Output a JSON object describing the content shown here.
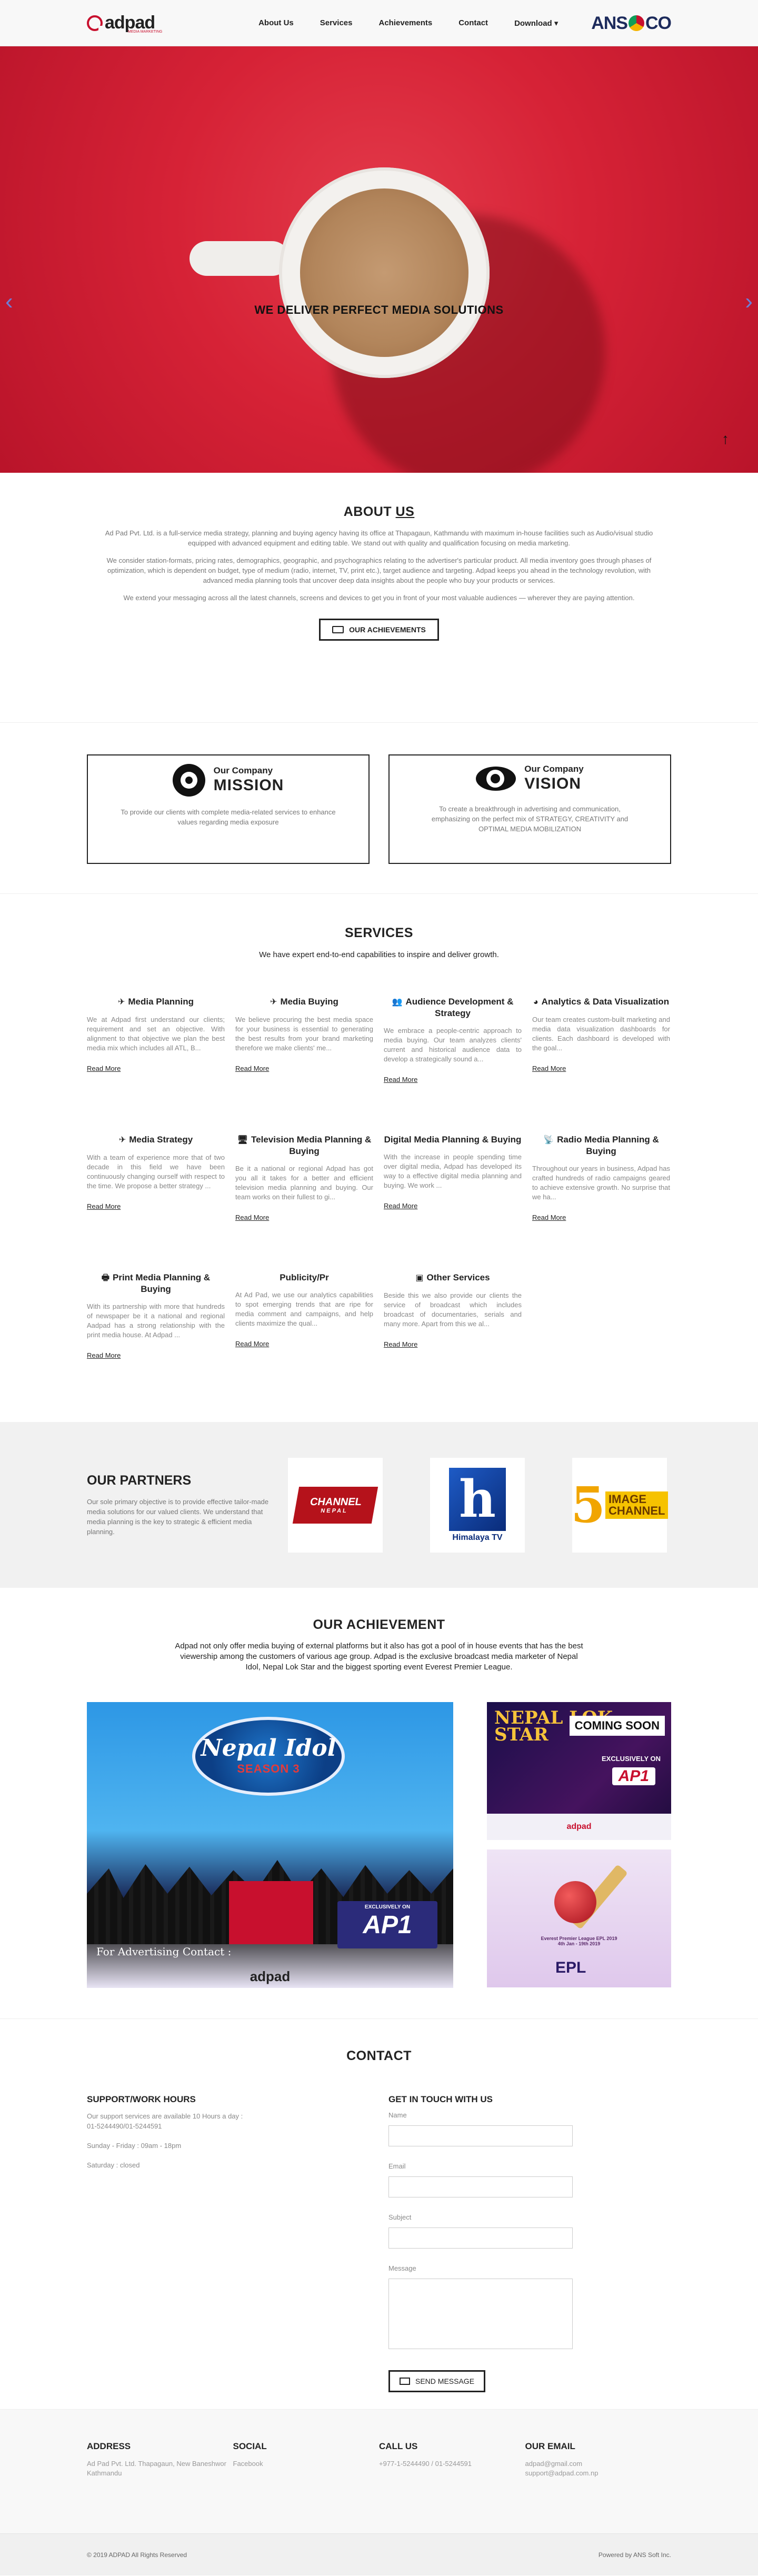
{
  "nav": {
    "logo_text": "adpad",
    "logo_sub": "MEDIA MARKETING",
    "links": [
      "About Us",
      "Services",
      "Achievements",
      "Contact",
      "Download"
    ],
    "partner_logo": "ANSCO"
  },
  "hero": {
    "caption": "WE DELIVER PERFECT MEDIA SOLUTIONS",
    "prev_icon": "‹",
    "next_icon": "›",
    "scroll_top_icon": "↑"
  },
  "about": {
    "title_a": "ABOUT ",
    "title_b": "US",
    "p1": "Ad Pad Pvt. Ltd. is a full-service media strategy, planning and buying agency having its office at Thapagaun, Kathmandu with maximum in-house facilities such as Audio/visual studio equipped with advanced equipment and editing table. We stand out with quality and qualification focusing on media marketing.",
    "p2": "We consider station-formats, pricing rates, demographics, geographic, and psychographics relating to the advertiser's particular product. All media inventory goes through phases of optimization, which is dependent on budget, type of medium (radio, internet, TV, print etc.), target audience and targeting. Adpad keeps you ahead in the technology revolution, with advanced media planning tools that uncover deep data insights about the people who buy your products or services.",
    "p3": "We extend your messaging across all the latest channels, screens and devices to get you in front of your most valuable audiences — wherever they are paying attention.",
    "button": "OUR ACHIEVEMENTS"
  },
  "mission": {
    "prefix": "Our Company",
    "title": "MISSION",
    "text": "To provide our clients with complete media-related services to enhance values regarding media exposure"
  },
  "vision": {
    "prefix": "Our Company",
    "title": "VISION",
    "text": "To create a breakthrough in advertising and communication, emphasizing on the perfect mix of STRATEGY, CREATIVITY and OPTIMAL MEDIA MOBILIZATION"
  },
  "services": {
    "title": "SERVICES",
    "subtitle": "We have expert end-to-end capabilities to inspire and deliver growth.",
    "read_more": "Read More",
    "items": [
      {
        "icon": "✈",
        "title": "Media Planning",
        "text": "We at Adpad first understand our clients; requirement and set an objective. With alignment to that objective we plan the best media mix which includes all ATL, B..."
      },
      {
        "icon": "✈",
        "title": "Media Buying",
        "text": "We believe procuring the best media space for your business is essential to generating the best results from your brand marketing therefore we make clients' me..."
      },
      {
        "icon": "👥",
        "title": "Audience Development & Strategy",
        "text": "We embrace a people-centric approach to media buying. Our team analyzes clients' current and historical audience data to develop a strategically sound a..."
      },
      {
        "icon": "◕",
        "title": "Analytics & Data Visualization",
        "text": "Our team creates custom-built marketing and media data visualization dashboards for clients. Each dashboard is developed with the goal..."
      },
      {
        "icon": "✈",
        "title": "Media Strategy",
        "text": "With a team of experience more that of two decade in this field we have been continuously changing ourself with respect to the time. We propose a better strategy ..."
      },
      {
        "icon": "🖥",
        "title": "Television Media Planning & Buying",
        "text": "Be it a national or regional Adpad has got you all it takes for a better and efficient television media planning and buying. Our team works on their fullest to gi..."
      },
      {
        "icon": "",
        "title": "Digital Media Planning & Buying",
        "text": "With the increase in people spending time over digital media, Adpad has developed its way to a effective digital media planning and buying. We work ..."
      },
      {
        "icon": "📡",
        "title": "Radio Media Planning & Buying",
        "text": "Throughout our years in business, Adpad has crafted hundreds of radio campaigns geared to achieve extensive growth. No surprise that we ha..."
      },
      {
        "icon": "🖶",
        "title": "Print Media Planning & Buying",
        "text": "With its partnership with more that hundreds of newspaper be it a national and regional Aadpad has a strong relationship with the print media house. At Adpad ..."
      },
      {
        "icon": "",
        "title": "Publicity/Pr",
        "text": "At Ad Pad, we use our analytics capabilities to spot emerging trends that are ripe for media comment and campaigns, and help clients maximize the qual..."
      },
      {
        "icon": "▣",
        "title": "Other Services",
        "text": "Beside this we also provide our clients the service of broadcast which includes broadcast of documentaries, serials and many more. Apart from this we al..."
      }
    ]
  },
  "partners": {
    "title": "OUR PARTNERS",
    "text": "Our sole primary objective is to provide effective tailor-made media solutions for our valued clients. We understand that media planning is the key to strategic & efficient media planning.",
    "logos": [
      {
        "name": "CHANNEL",
        "sub": "NEPAL"
      },
      {
        "name": "h",
        "sub": "Himalaya TV"
      },
      {
        "name": "5",
        "sub": "IMAGE CHANNEL"
      }
    ]
  },
  "achievement": {
    "title": "OUR ACHIEVEMENT",
    "text": "Adpad not only offer media buying of external platforms but it also has got a pool of in house events that has the best viewership among the customers of various age group. Adpad is the exclusive broadcast media marketer of Nepal Idol, Nepal Lok Star and the biggest sporting event Everest Premier League.",
    "idol_title": "Nepal Idol",
    "idol_season": "SEASON 3",
    "idol_contact": "For Advertising Contact :",
    "idol_channel": "AP1",
    "idol_exclusive": "EXCLUSIVELY ON",
    "idol_bottom": "adpad",
    "lokstar_title": "NEPAL LOK STAR",
    "lokstar_coming": "COMING SOON",
    "lokstar_exclusive": "EXCLUSIVELY ON",
    "lokstar_channel": "AP1",
    "lokstar_foot": "adpad",
    "epl_line": "Everest Premier League EPL 2019",
    "epl_dates": "4th Jan - 19th 2019",
    "epl_name": "EPL"
  },
  "contact": {
    "title": "CONTACT",
    "hours_title": "SUPPORT/WORK HOURS",
    "hours_text": "Our support services are available 10 Hours a day :",
    "phone": "01-5244490/01-5244591",
    "weekdays": "Sunday - Friday : 09am - 18pm",
    "saturday": "Saturday : closed",
    "form_title": "GET IN TOUCH WITH US",
    "name_label": "Name",
    "email_label": "Email",
    "subject_label": "Subject",
    "message_label": "Message",
    "send": "SEND MESSAGE"
  },
  "footer": {
    "address_title": "ADDRESS",
    "address": "Ad Pad Pvt. Ltd. Thapagaun, New Baneshwor Kathmandu",
    "social_title": "SOCIAL",
    "social": "Facebook",
    "call_title": "CALL US",
    "call": "+977-1-5244490 / 01-5244591",
    "email_title": "OUR EMAIL",
    "email1": "adpad@gmail.com",
    "email2": "support@adpad.com.np",
    "copyright": "© 2019 ADPAD All Rights Reserved",
    "powered": "Powered by ANS Soft Inc."
  }
}
